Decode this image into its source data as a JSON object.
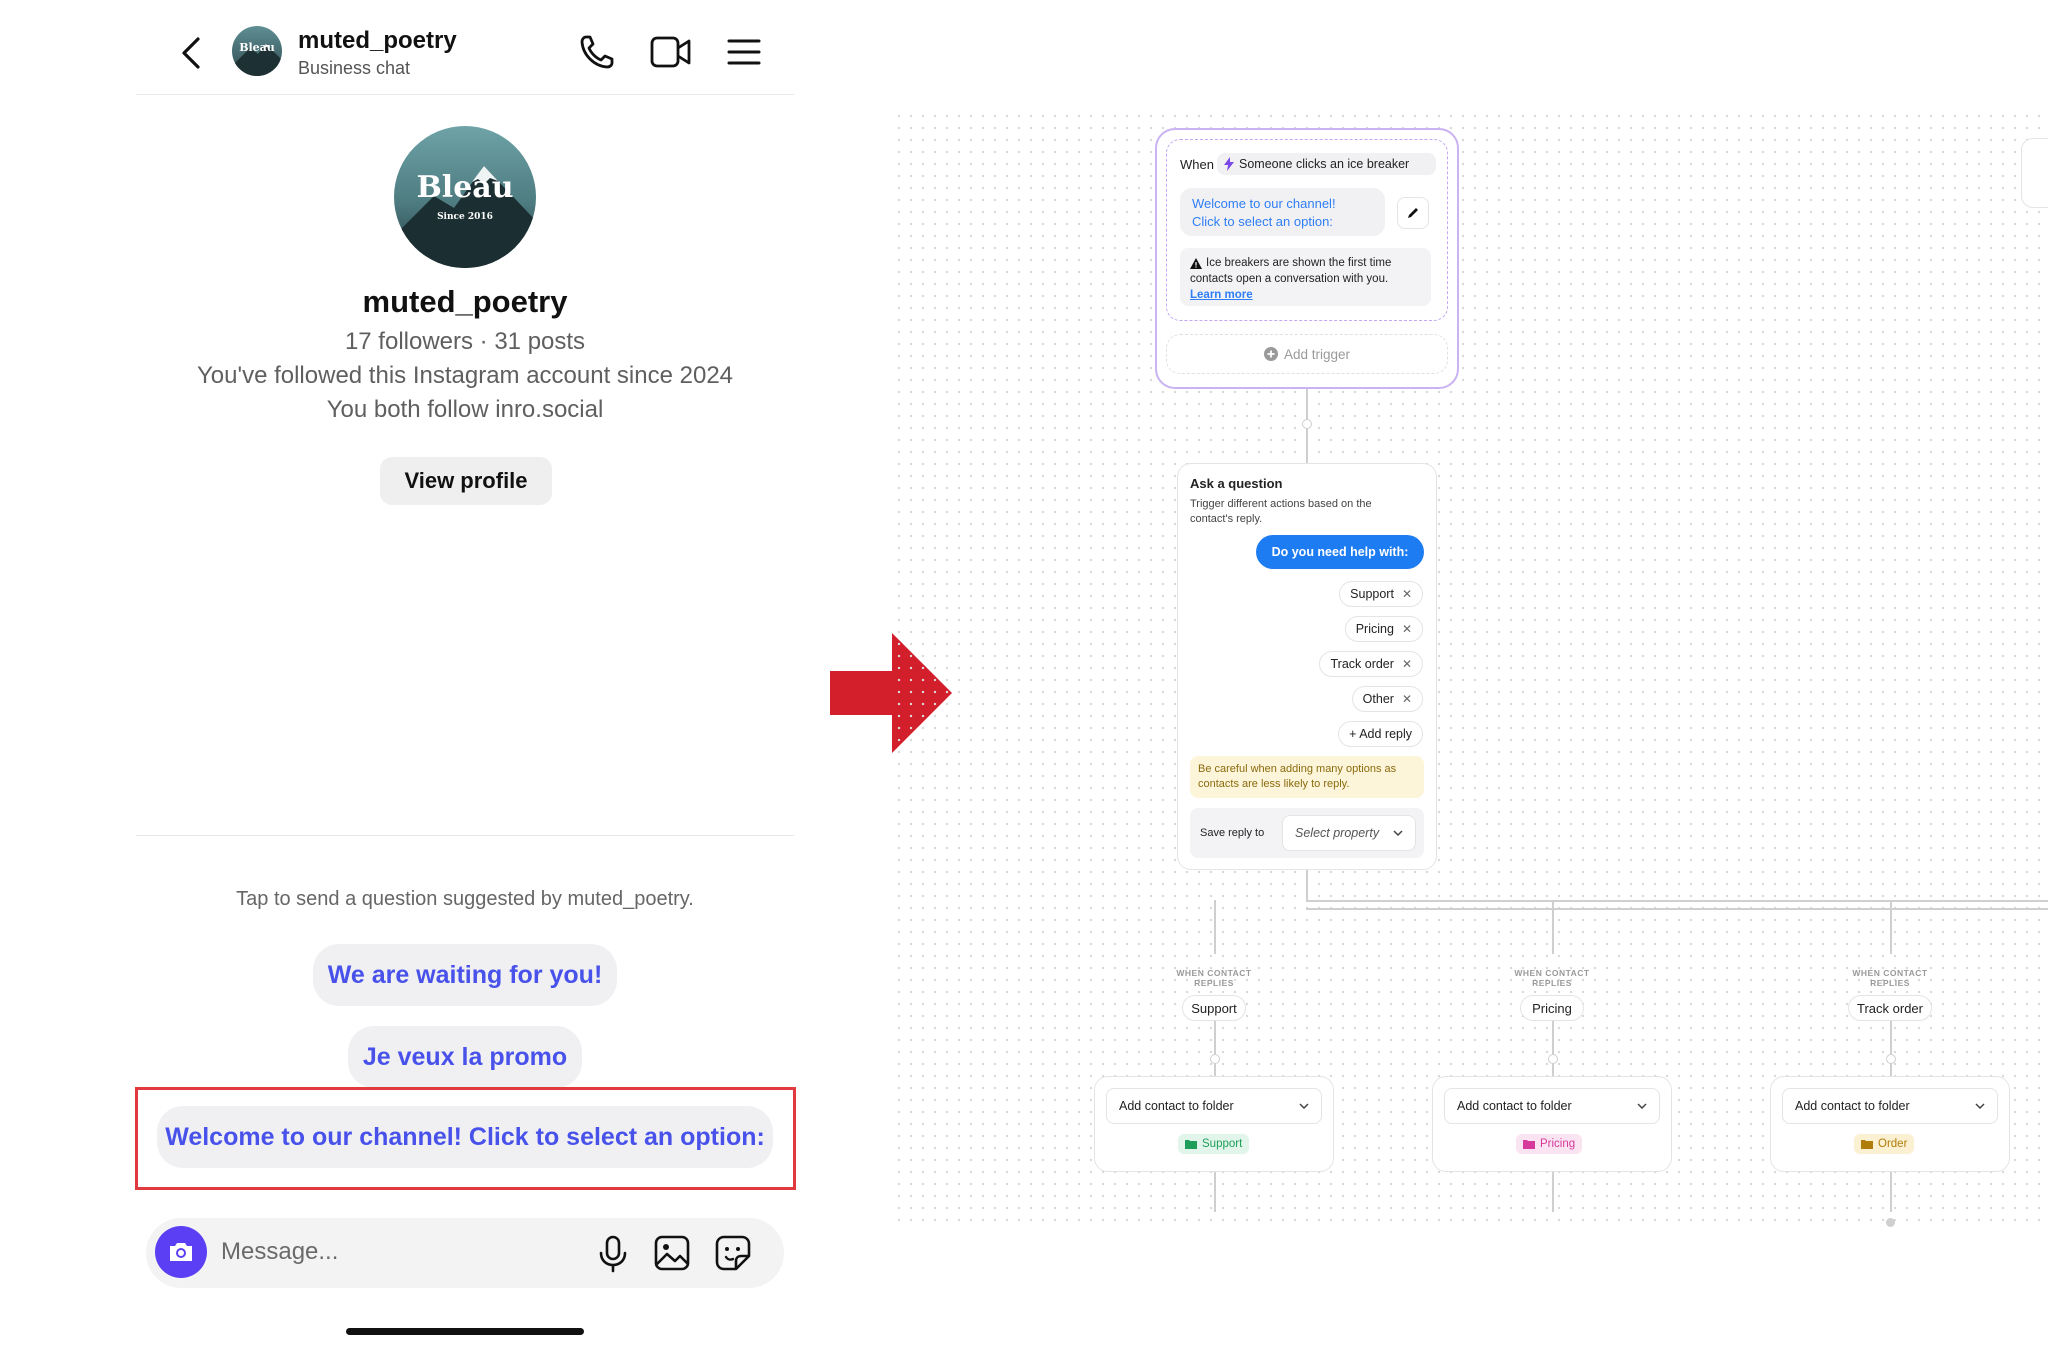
{
  "phone": {
    "header": {
      "username": "muted_poetry",
      "subtitle": "Business chat"
    },
    "profile": {
      "avatar_text": "Bleau",
      "avatar_subtext": "Since 2016",
      "name": "muted_poetry",
      "stats": "17 followers · 31 posts",
      "followed_since": "You've followed this Instagram account since 2024",
      "mutual": "You both follow inro.social",
      "view_profile_label": "View profile"
    },
    "suggestions": {
      "hint": "Tap to send a question suggested by muted_poetry.",
      "items": [
        "We are waiting for you!",
        "Je veux la promo",
        "Welcome to our channel! Click to select an option:"
      ]
    },
    "composer": {
      "placeholder": "Message..."
    }
  },
  "colors": {
    "arrow": "#d21f2b",
    "highlight_border": "#e0393e",
    "link_blue": "#4852ea",
    "trigger_border": "#c9b3f2",
    "primary_blue": "#1e7cf2"
  },
  "flow": {
    "trigger": {
      "when_label": "When",
      "event": "Someone clicks an ice breaker",
      "message_line1": "Welcome to our channel!",
      "message_line2": "Click to select an option:",
      "notice_line1": "Ice breakers are shown the first time",
      "notice_line2": "contacts open a conversation with you.",
      "learn_more": "Learn more",
      "add_trigger": "Add trigger"
    },
    "question": {
      "title": "Ask a question",
      "desc_line1": "Trigger different actions based on the",
      "desc_line2": "contact's reply.",
      "prompt": "Do you need help with:",
      "replies": [
        "Support",
        "Pricing",
        "Track order",
        "Other"
      ],
      "add_reply": "+ Add reply",
      "warning_line1": "Be careful when adding many options as",
      "warning_line2": "contacts are less likely to reply.",
      "save_reply_label": "Save reply to",
      "select_property": "Select property"
    },
    "branches": [
      {
        "cond_line1": "WHEN CONTACT",
        "cond_line2": "REPLIES",
        "reply": "Support",
        "action": "Add contact to folder",
        "folder": "Support",
        "folder_color": "#1e9e5a",
        "folder_bg": "#e2f5ea"
      },
      {
        "cond_line1": "WHEN CONTACT",
        "cond_line2": "REPLIES",
        "reply": "Pricing",
        "action": "Add contact to folder",
        "folder": "Pricing",
        "folder_color": "#d63a9c",
        "folder_bg": "#fbe4f1"
      },
      {
        "cond_line1": "WHEN CONTACT",
        "cond_line2": "REPLIES",
        "reply": "Track order",
        "action": "Add contact to folder",
        "folder": "Order",
        "folder_color": "#b07d0a",
        "folder_bg": "#fbf0d2"
      }
    ]
  }
}
